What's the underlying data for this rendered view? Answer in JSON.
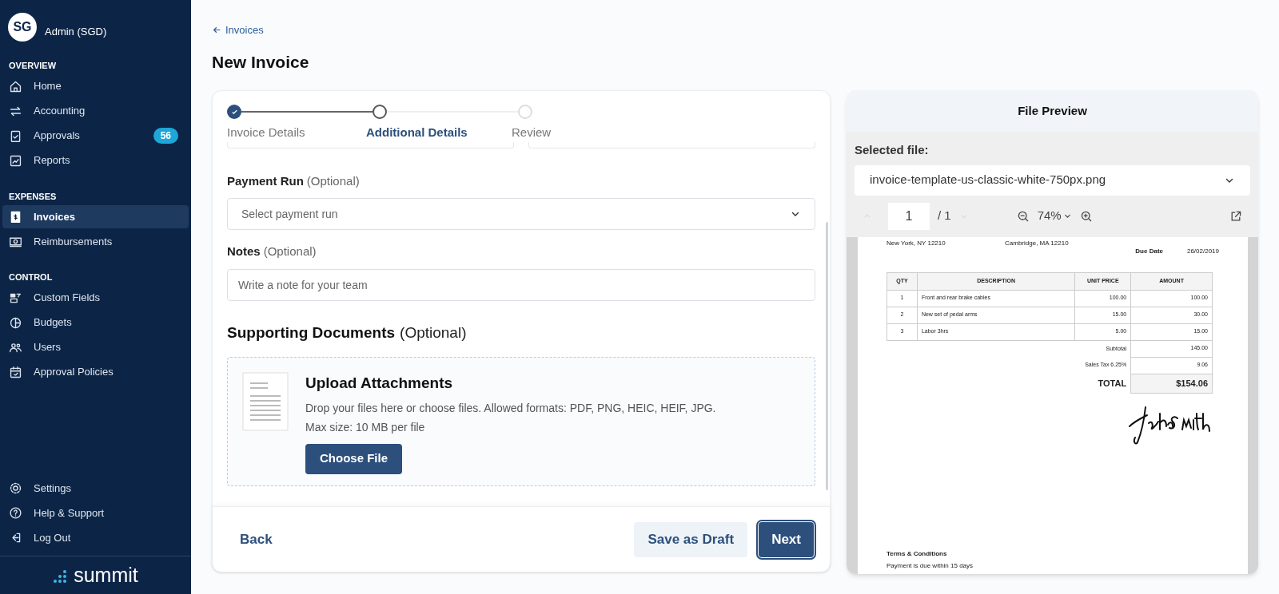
{
  "sidebar": {
    "user": {
      "initials": "SG",
      "name": "Admin (SGD)"
    },
    "sections": [
      {
        "title": "OVERVIEW",
        "items": [
          {
            "label": "Home",
            "selected": false
          },
          {
            "label": "Accounting",
            "selected": false
          },
          {
            "label": "Approvals",
            "selected": false,
            "badge": "56"
          },
          {
            "label": "Reports",
            "selected": false
          }
        ]
      },
      {
        "title": "EXPENSES",
        "items": [
          {
            "label": "Invoices",
            "selected": true
          },
          {
            "label": "Reimbursements",
            "selected": false
          }
        ]
      },
      {
        "title": "CONTROL",
        "items": [
          {
            "label": "Custom Fields",
            "selected": false
          },
          {
            "label": "Budgets",
            "selected": false
          },
          {
            "label": "Users",
            "selected": false
          },
          {
            "label": "Approval Policies",
            "selected": false
          }
        ]
      }
    ],
    "bottom_items": [
      {
        "label": "Settings"
      },
      {
        "label": "Help & Support"
      },
      {
        "label": "Log Out"
      }
    ],
    "logo": "summit"
  },
  "back_link": "Invoices",
  "page_title": "New Invoice",
  "form": {
    "steps": [
      {
        "label": "Invoice Details",
        "done": true,
        "selected": false
      },
      {
        "label": "Additional Details",
        "done": false,
        "selected": true
      },
      {
        "label": "Review",
        "done": false,
        "selected": false
      }
    ],
    "payment_run": {
      "label": "Payment Run",
      "hint": "(Optional)",
      "placeholder": "Select payment run"
    },
    "notes": {
      "label": "Notes",
      "hint": "(Optional)",
      "placeholder": "Write a note for your team"
    },
    "supporting": {
      "title": "Supporting Documents",
      "hint": "(Optional)"
    },
    "upload": {
      "title": "Upload Attachments",
      "text": "Drop your files here or choose files. Allowed formats: PDF, PNG, HEIC, HEIF, JPG.",
      "limit": "Max size: 10 MB per file",
      "button": "Choose File"
    },
    "footer": {
      "back": "Back",
      "draft": "Save as Draft",
      "next": "Next"
    }
  },
  "preview": {
    "title": "File Preview",
    "selected_label": "Selected file:",
    "file": "invoice-template-us-classic-white-750px.png",
    "page": "1",
    "pages": "/ 1",
    "zoom": "74%",
    "document": {
      "from_city": "New York, NY 12210",
      "to_city": "Cambridge, MA 12210",
      "meta": [
        {
          "label": "Due Date",
          "value": "26/02/2019"
        }
      ],
      "columns": [
        "QTY",
        "DESCRIPTION",
        "UNIT PRICE",
        "AMOUNT"
      ],
      "rows": [
        [
          "1",
          "Front and rear brake cables",
          "100.00",
          "100.00"
        ],
        [
          "2",
          "New set of pedal arms",
          "15.00",
          "30.00"
        ],
        [
          "3",
          "Labor 3hrs",
          "5.00",
          "15.00"
        ]
      ],
      "subtotal": {
        "label": "Subtotal",
        "value": "145.00"
      },
      "tax": {
        "label": "Sales Tax 6.25%",
        "value": "9.06"
      },
      "total": {
        "label": "TOTAL",
        "value": "$154.06"
      },
      "terms_title": "Terms & Conditions",
      "terms": "Payment is due within 15 days"
    }
  }
}
